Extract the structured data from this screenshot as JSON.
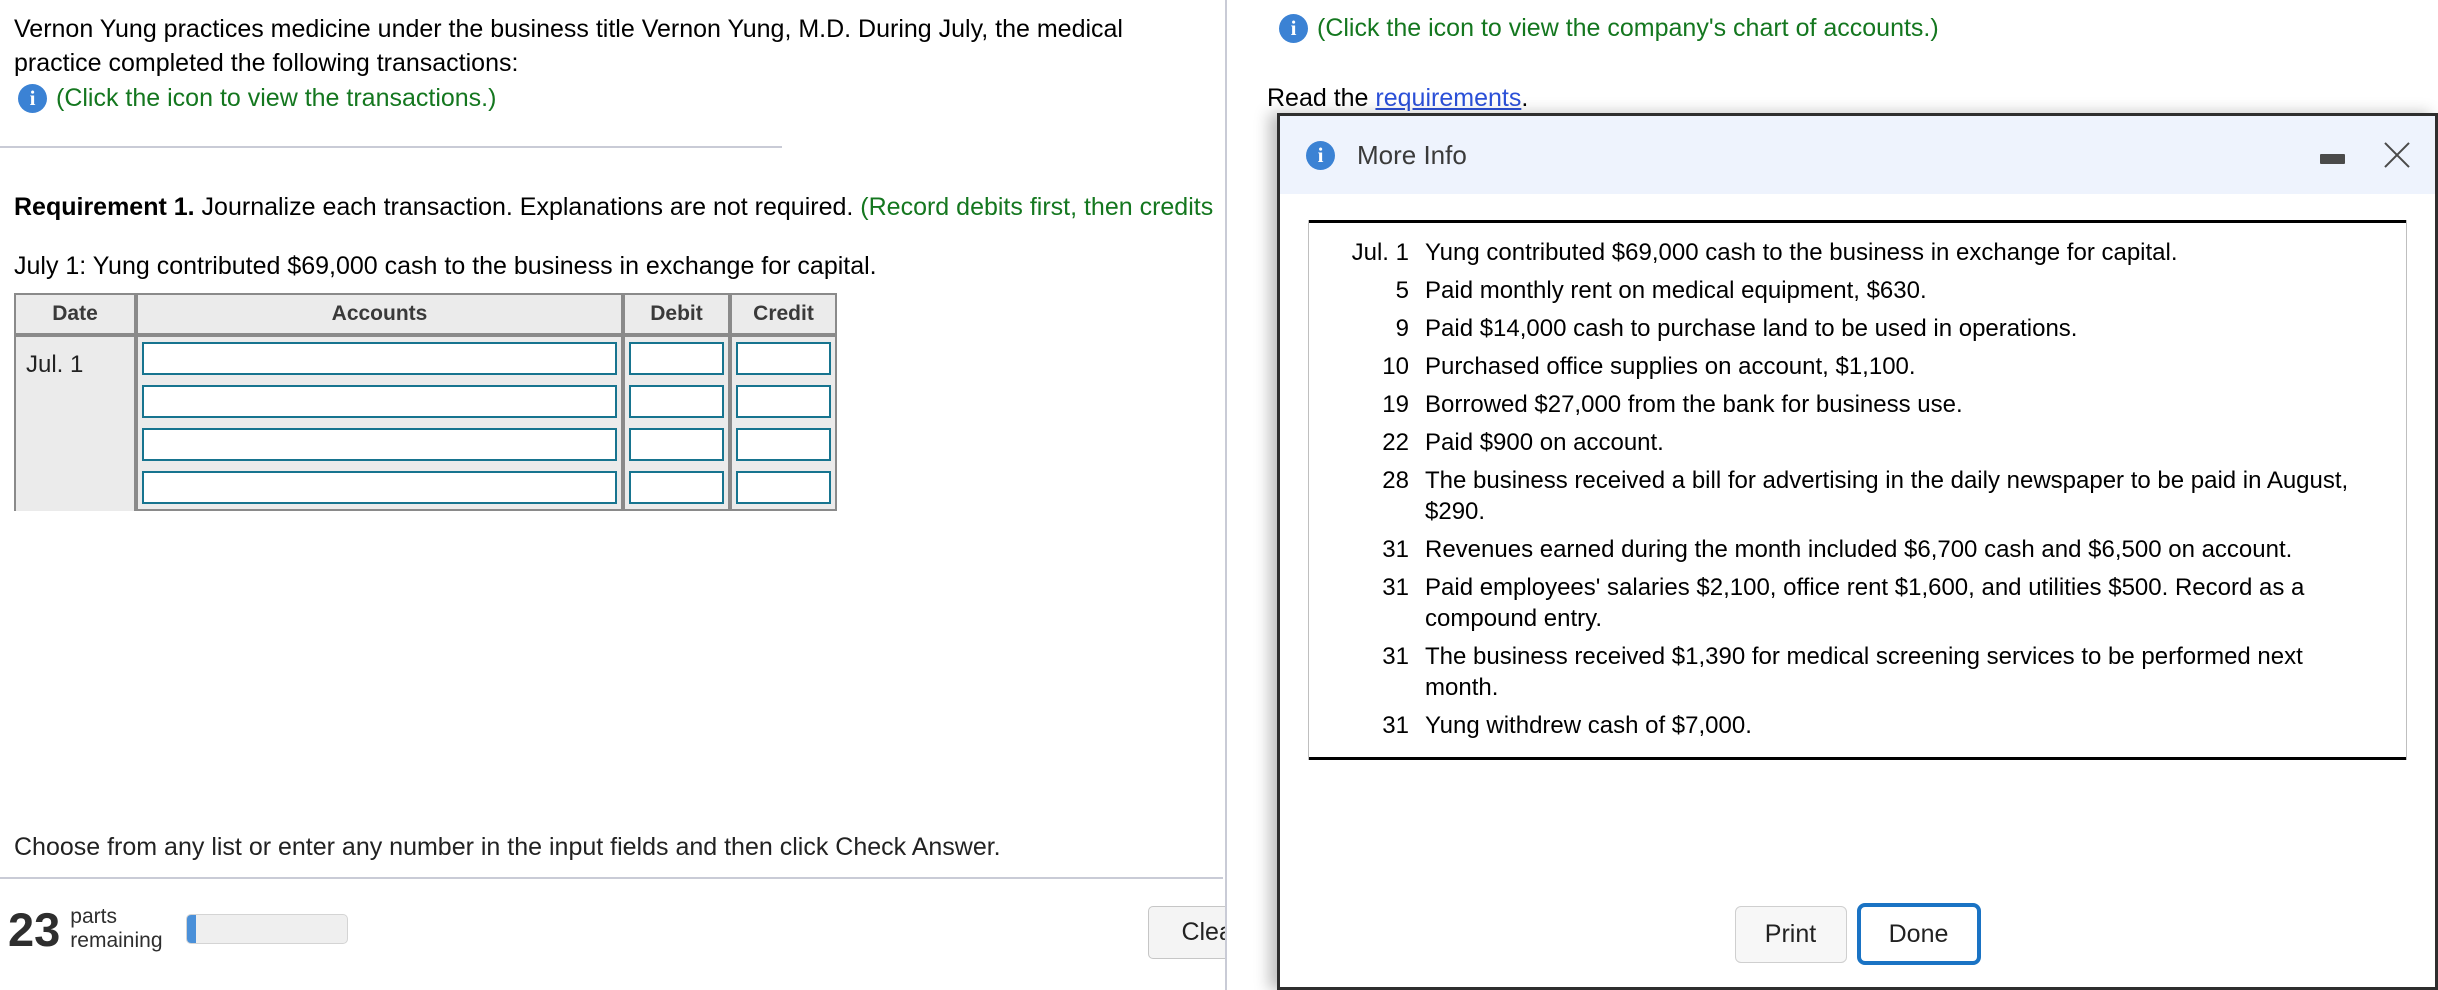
{
  "left": {
    "intro": "Vernon Yung practices medicine under the business title Vernon Yung, M.D. During July, the medical practice completed the following transactions:",
    "transactions_link": "(Click the icon to view the transactions.)",
    "requirement_label": "Requirement 1.",
    "requirement_text": " Journalize each transaction. Explanations are not required. ",
    "requirement_green": "(Record debits first, then credits",
    "july_line": "July 1: Yung contributed $69,000 cash to the business in exchange for capital.",
    "hint": "Choose from any list or enter any number in the input fields and then click Check Answer.",
    "parts_count": "23",
    "parts_label_line1": "parts",
    "parts_label_line2": "remaining",
    "clear_all_label": "Clear All",
    "info_icon_glyph": "i"
  },
  "journal": {
    "headers": [
      "Date",
      "Accounts",
      "Debit",
      "Credit"
    ],
    "rows": [
      {
        "date": "Jul. 1",
        "accounts": "",
        "debit": "",
        "credit": ""
      },
      {
        "date": "",
        "accounts": "",
        "debit": "",
        "credit": ""
      },
      {
        "date": "",
        "accounts": "",
        "debit": "",
        "credit": ""
      },
      {
        "date": "",
        "accounts": "",
        "debit": "",
        "credit": ""
      }
    ]
  },
  "right": {
    "chart_link": "(Click the icon to view the company's chart of accounts.)",
    "read_prefix": "Read the ",
    "read_link": "requirements",
    "read_suffix": "."
  },
  "modal": {
    "title": "More Info",
    "info_icon_glyph": "i",
    "transactions": [
      {
        "date": "Jul. 1",
        "desc": "Yung contributed $69,000 cash to the business in exchange for capital."
      },
      {
        "date": "5",
        "desc": "Paid monthly rent on medical equipment, $630."
      },
      {
        "date": "9",
        "desc": "Paid $14,000 cash to purchase land to be used in operations."
      },
      {
        "date": "10",
        "desc": "Purchased office supplies on account, $1,100."
      },
      {
        "date": "19",
        "desc": "Borrowed $27,000 from the bank for business use."
      },
      {
        "date": "22",
        "desc": "Paid $900 on account."
      },
      {
        "date": "28",
        "desc": "The business received a bill for advertising in the daily newspaper to be paid in August, $290."
      },
      {
        "date": "31",
        "desc": "Revenues earned during the month included $6,700 cash and $6,500 on account."
      },
      {
        "date": "31",
        "desc": "Paid employees' salaries $2,100, office rent $1,600, and utilities $500. Record as a compound entry."
      },
      {
        "date": "31",
        "desc": "The business received $1,390 for medical screening services to be performed next month."
      },
      {
        "date": "31",
        "desc": "Yung withdrew cash of $7,000."
      }
    ],
    "print_label": "Print",
    "done_label": "Done"
  },
  "colors": {
    "accent_blue": "#3b82d4",
    "green_text": "#14771f",
    "link_blue": "#2b50d8",
    "input_border": "#17748f",
    "done_border": "#1a73c4",
    "modal_header_bg": "#eef3fd"
  }
}
